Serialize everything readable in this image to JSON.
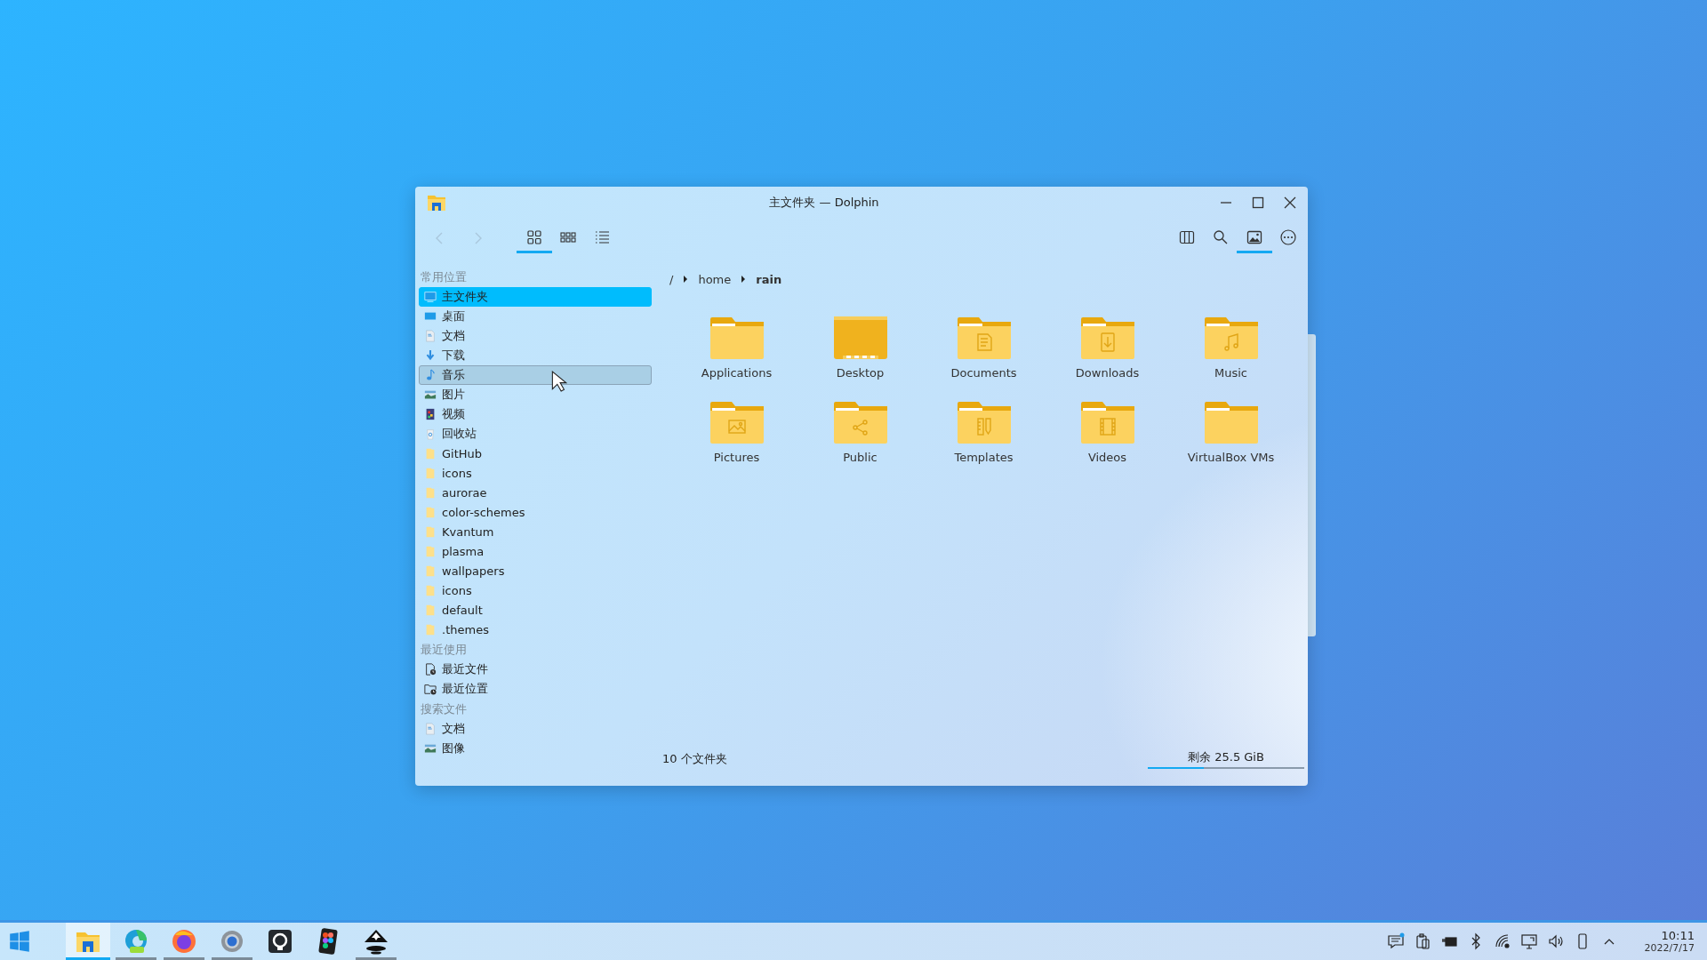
{
  "window": {
    "title": "主文件夹 — Dolphin"
  },
  "toolbar": {
    "view_modes": [
      {
        "kind": "icons",
        "selected": true
      },
      {
        "kind": "compact",
        "selected": false
      },
      {
        "kind": "details",
        "selected": false
      }
    ],
    "actions": [
      {
        "kind": "split",
        "selected": false
      },
      {
        "kind": "search",
        "selected": false
      },
      {
        "kind": "preview",
        "selected": true
      },
      {
        "kind": "menu",
        "selected": false
      }
    ]
  },
  "sidebar": {
    "sections": [
      {
        "title": "常用位置",
        "items": [
          {
            "label": "主文件夹",
            "kind": "home",
            "selected": true,
            "hovered": false
          },
          {
            "label": "桌面",
            "kind": "desktop",
            "selected": false,
            "hovered": false
          },
          {
            "label": "文档",
            "kind": "document",
            "selected": false,
            "hovered": false
          },
          {
            "label": "下载",
            "kind": "download",
            "selected": false,
            "hovered": false
          },
          {
            "label": "音乐",
            "kind": "music",
            "selected": false,
            "hovered": true
          },
          {
            "label": "图片",
            "kind": "picture",
            "selected": false,
            "hovered": false
          },
          {
            "label": "视频",
            "kind": "video",
            "selected": false,
            "hovered": false
          },
          {
            "label": "回收站",
            "kind": "trash",
            "selected": false,
            "hovered": false
          },
          {
            "label": "GitHub",
            "kind": "folder",
            "selected": false,
            "hovered": false
          },
          {
            "label": "icons",
            "kind": "folder",
            "selected": false,
            "hovered": false
          },
          {
            "label": "aurorae",
            "kind": "folder",
            "selected": false,
            "hovered": false
          },
          {
            "label": "color-schemes",
            "kind": "folder",
            "selected": false,
            "hovered": false
          },
          {
            "label": "Kvantum",
            "kind": "folder",
            "selected": false,
            "hovered": false
          },
          {
            "label": "plasma",
            "kind": "folder",
            "selected": false,
            "hovered": false
          },
          {
            "label": "wallpapers",
            "kind": "folder",
            "selected": false,
            "hovered": false
          },
          {
            "label": "icons",
            "kind": "folder",
            "selected": false,
            "hovered": false
          },
          {
            "label": "default",
            "kind": "folder",
            "selected": false,
            "hovered": false
          },
          {
            "label": ".themes",
            "kind": "folder",
            "selected": false,
            "hovered": false
          }
        ]
      },
      {
        "title": "最近使用",
        "items": [
          {
            "label": "最近文件",
            "kind": "recent-files",
            "selected": false,
            "hovered": false
          },
          {
            "label": "最近位置",
            "kind": "recent-places",
            "selected": false,
            "hovered": false
          }
        ]
      },
      {
        "title": "搜索文件",
        "items": [
          {
            "label": "文档",
            "kind": "document",
            "selected": false,
            "hovered": false
          },
          {
            "label": "图像",
            "kind": "picture",
            "selected": false,
            "hovered": false
          }
        ]
      }
    ]
  },
  "breadcrumb": [
    {
      "label": "/",
      "current": false
    },
    {
      "label": "home",
      "current": false
    },
    {
      "label": "rain",
      "current": true
    }
  ],
  "files": [
    {
      "name": "Applications",
      "kind": "plain"
    },
    {
      "name": "Desktop",
      "kind": "desktop"
    },
    {
      "name": "Documents",
      "kind": "document"
    },
    {
      "name": "Downloads",
      "kind": "download"
    },
    {
      "name": "Music",
      "kind": "music"
    },
    {
      "name": "Pictures",
      "kind": "picture"
    },
    {
      "name": "Public",
      "kind": "share"
    },
    {
      "name": "Templates",
      "kind": "template"
    },
    {
      "name": "Videos",
      "kind": "video"
    },
    {
      "name": "VirtualBox VMs",
      "kind": "plain"
    }
  ],
  "status_bar": {
    "summary": "10 个文件夹",
    "free_space": "剩余 25.5 GiB",
    "level": 0.36
  },
  "taskbar": {
    "apps": [
      {
        "kind": "files",
        "selected": true,
        "running": true
      },
      {
        "kind": "edge",
        "selected": false,
        "running": true
      },
      {
        "kind": "firefox",
        "selected": false,
        "running": true
      },
      {
        "kind": "settings",
        "selected": false,
        "running": true
      },
      {
        "kind": "github",
        "selected": false,
        "running": false
      },
      {
        "kind": "figma",
        "selected": false,
        "running": false
      },
      {
        "kind": "inkscape",
        "selected": false,
        "running": true
      }
    ],
    "tray": [
      {
        "kind": "notifications",
        "unread": true
      },
      {
        "kind": "clipboard",
        "unread": false
      },
      {
        "kind": "battery",
        "unread": false
      },
      {
        "kind": "bluetooth",
        "unread": false
      },
      {
        "kind": "network",
        "unread": false
      },
      {
        "kind": "display",
        "unread": false
      },
      {
        "kind": "volume",
        "unread": false
      },
      {
        "kind": "phone",
        "unread": false
      },
      {
        "kind": "expand",
        "unread": false
      }
    ],
    "clock": {
      "time": "10:11",
      "date": "2022/7/17"
    }
  }
}
